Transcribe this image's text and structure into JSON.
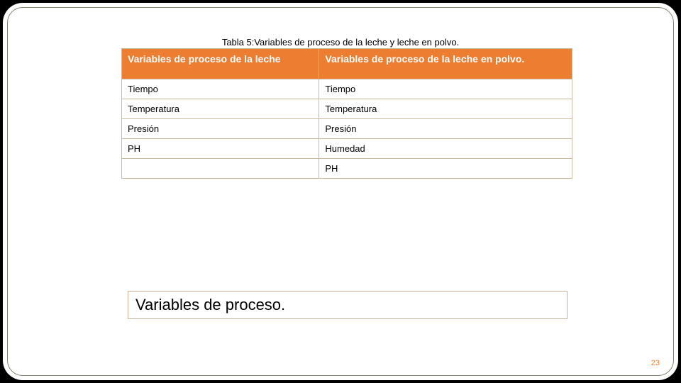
{
  "caption": "Tabla 5:Variables de proceso de la leche y leche en polvo.",
  "table": {
    "headers": {
      "col1": "Variables de proceso de la leche",
      "col2": "Variables de proceso de la leche en polvo."
    },
    "rows": [
      {
        "c1": "Tiempo",
        "c2": "Tiempo"
      },
      {
        "c1": "Temperatura",
        "c2": "Temperatura"
      },
      {
        "c1": "Presión",
        "c2": "Presión"
      },
      {
        "c1": "PH",
        "c2": "Humedad"
      },
      {
        "c1": "",
        "c2": "PH"
      }
    ]
  },
  "title": "Variables de proceso.",
  "page_number": "23"
}
